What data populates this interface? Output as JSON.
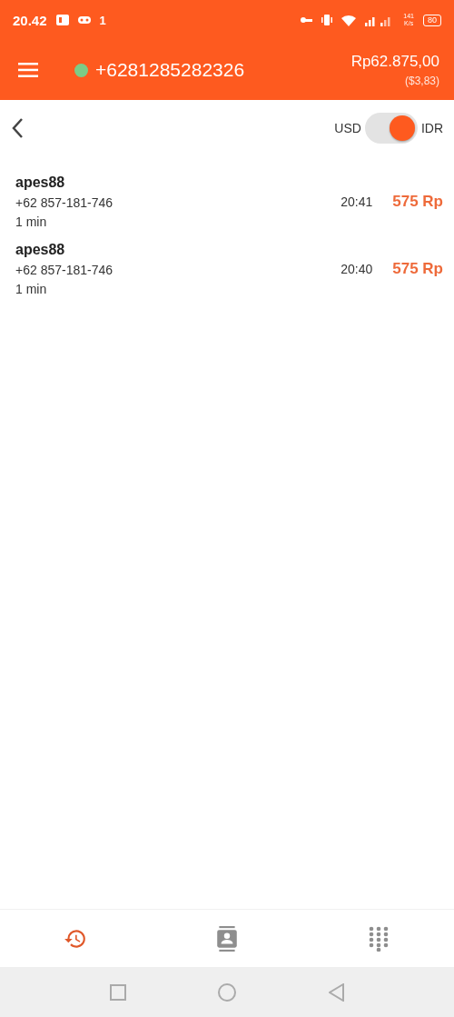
{
  "status_bar": {
    "time": "20.42",
    "notification_count": "1",
    "speed_value": "141",
    "speed_unit": "K/s",
    "battery": "80"
  },
  "app_bar": {
    "online": true,
    "phone": "+6281285282326",
    "balance": "Rp62.875,00",
    "balance_usd": "($3,83)"
  },
  "currency_toggle": {
    "left_label": "USD",
    "right_label": "IDR",
    "on": true
  },
  "calls": [
    {
      "name": "apes88",
      "number": "+62 857-181-746",
      "duration": "1 min",
      "time": "20:41",
      "cost": "575 Rp"
    },
    {
      "name": "apes88",
      "number": "+62 857-181-746",
      "duration": "1 min",
      "time": "20:40",
      "cost": "575 Rp"
    }
  ],
  "bottom_nav": [
    {
      "kind": "history",
      "selected": true
    },
    {
      "kind": "contacts",
      "selected": false
    },
    {
      "kind": "dialpad",
      "selected": false
    }
  ]
}
